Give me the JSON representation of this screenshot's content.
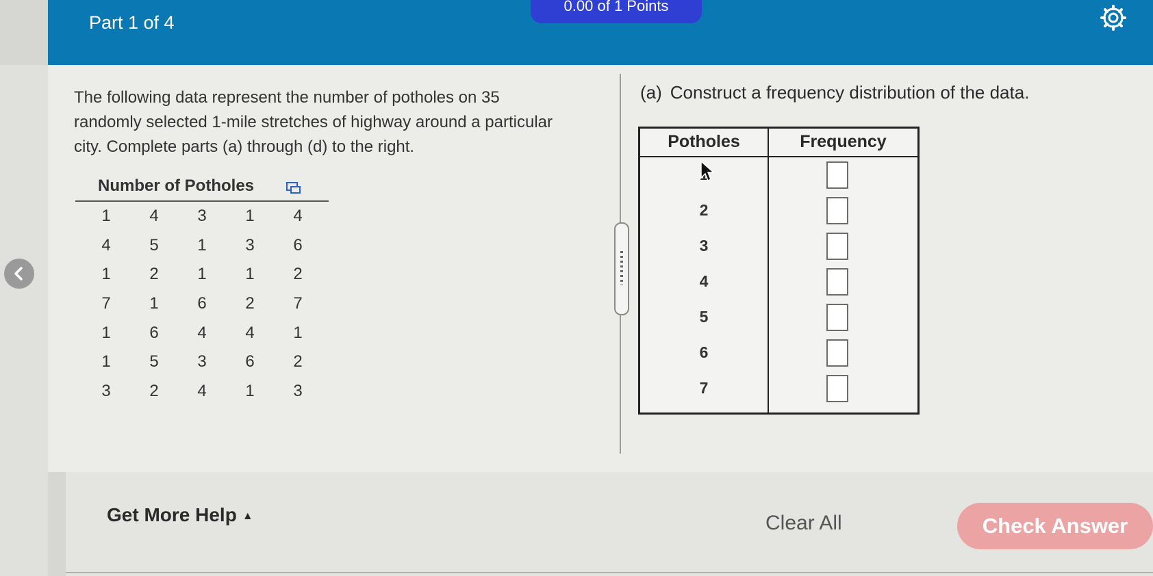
{
  "header": {
    "part_label": "Part 1 of 4",
    "score_text": "0.00 of 1 Points"
  },
  "question": {
    "intro": "The following data represent the number of potholes on 35 randomly selected 1-mile stretches of highway around a particular city. Complete parts (a) through (d) to the right.",
    "data_title": "Number of Potholes",
    "data_rows": [
      [
        "1",
        "4",
        "3",
        "1",
        "4"
      ],
      [
        "4",
        "5",
        "1",
        "3",
        "6"
      ],
      [
        "1",
        "2",
        "1",
        "1",
        "2"
      ],
      [
        "7",
        "1",
        "6",
        "2",
        "7"
      ],
      [
        "1",
        "6",
        "4",
        "4",
        "1"
      ],
      [
        "1",
        "5",
        "3",
        "6",
        "2"
      ],
      [
        "3",
        "2",
        "4",
        "1",
        "3"
      ]
    ]
  },
  "part_a": {
    "label": "(a)",
    "text": "Construct a frequency distribution of the data.",
    "table": {
      "col1": "Potholes",
      "col2": "Frequency",
      "rows": [
        {
          "potholes": "1",
          "frequency": ""
        },
        {
          "potholes": "2",
          "frequency": ""
        },
        {
          "potholes": "3",
          "frequency": ""
        },
        {
          "potholes": "4",
          "frequency": ""
        },
        {
          "potholes": "5",
          "frequency": ""
        },
        {
          "potholes": "6",
          "frequency": ""
        },
        {
          "potholes": "7",
          "frequency": ""
        }
      ]
    }
  },
  "footer": {
    "help_label": "Get More Help",
    "clear_label": "Clear All",
    "check_label": "Check Answer"
  },
  "colors": {
    "header_bg": "#0a78b3",
    "check_button": "#eba3a3",
    "score_pill": "#2f3fd3"
  },
  "icons": [
    "gear-icon",
    "back-arrow-icon",
    "copy-data-icon",
    "caret-up-icon",
    "mouse-cursor-icon"
  ]
}
